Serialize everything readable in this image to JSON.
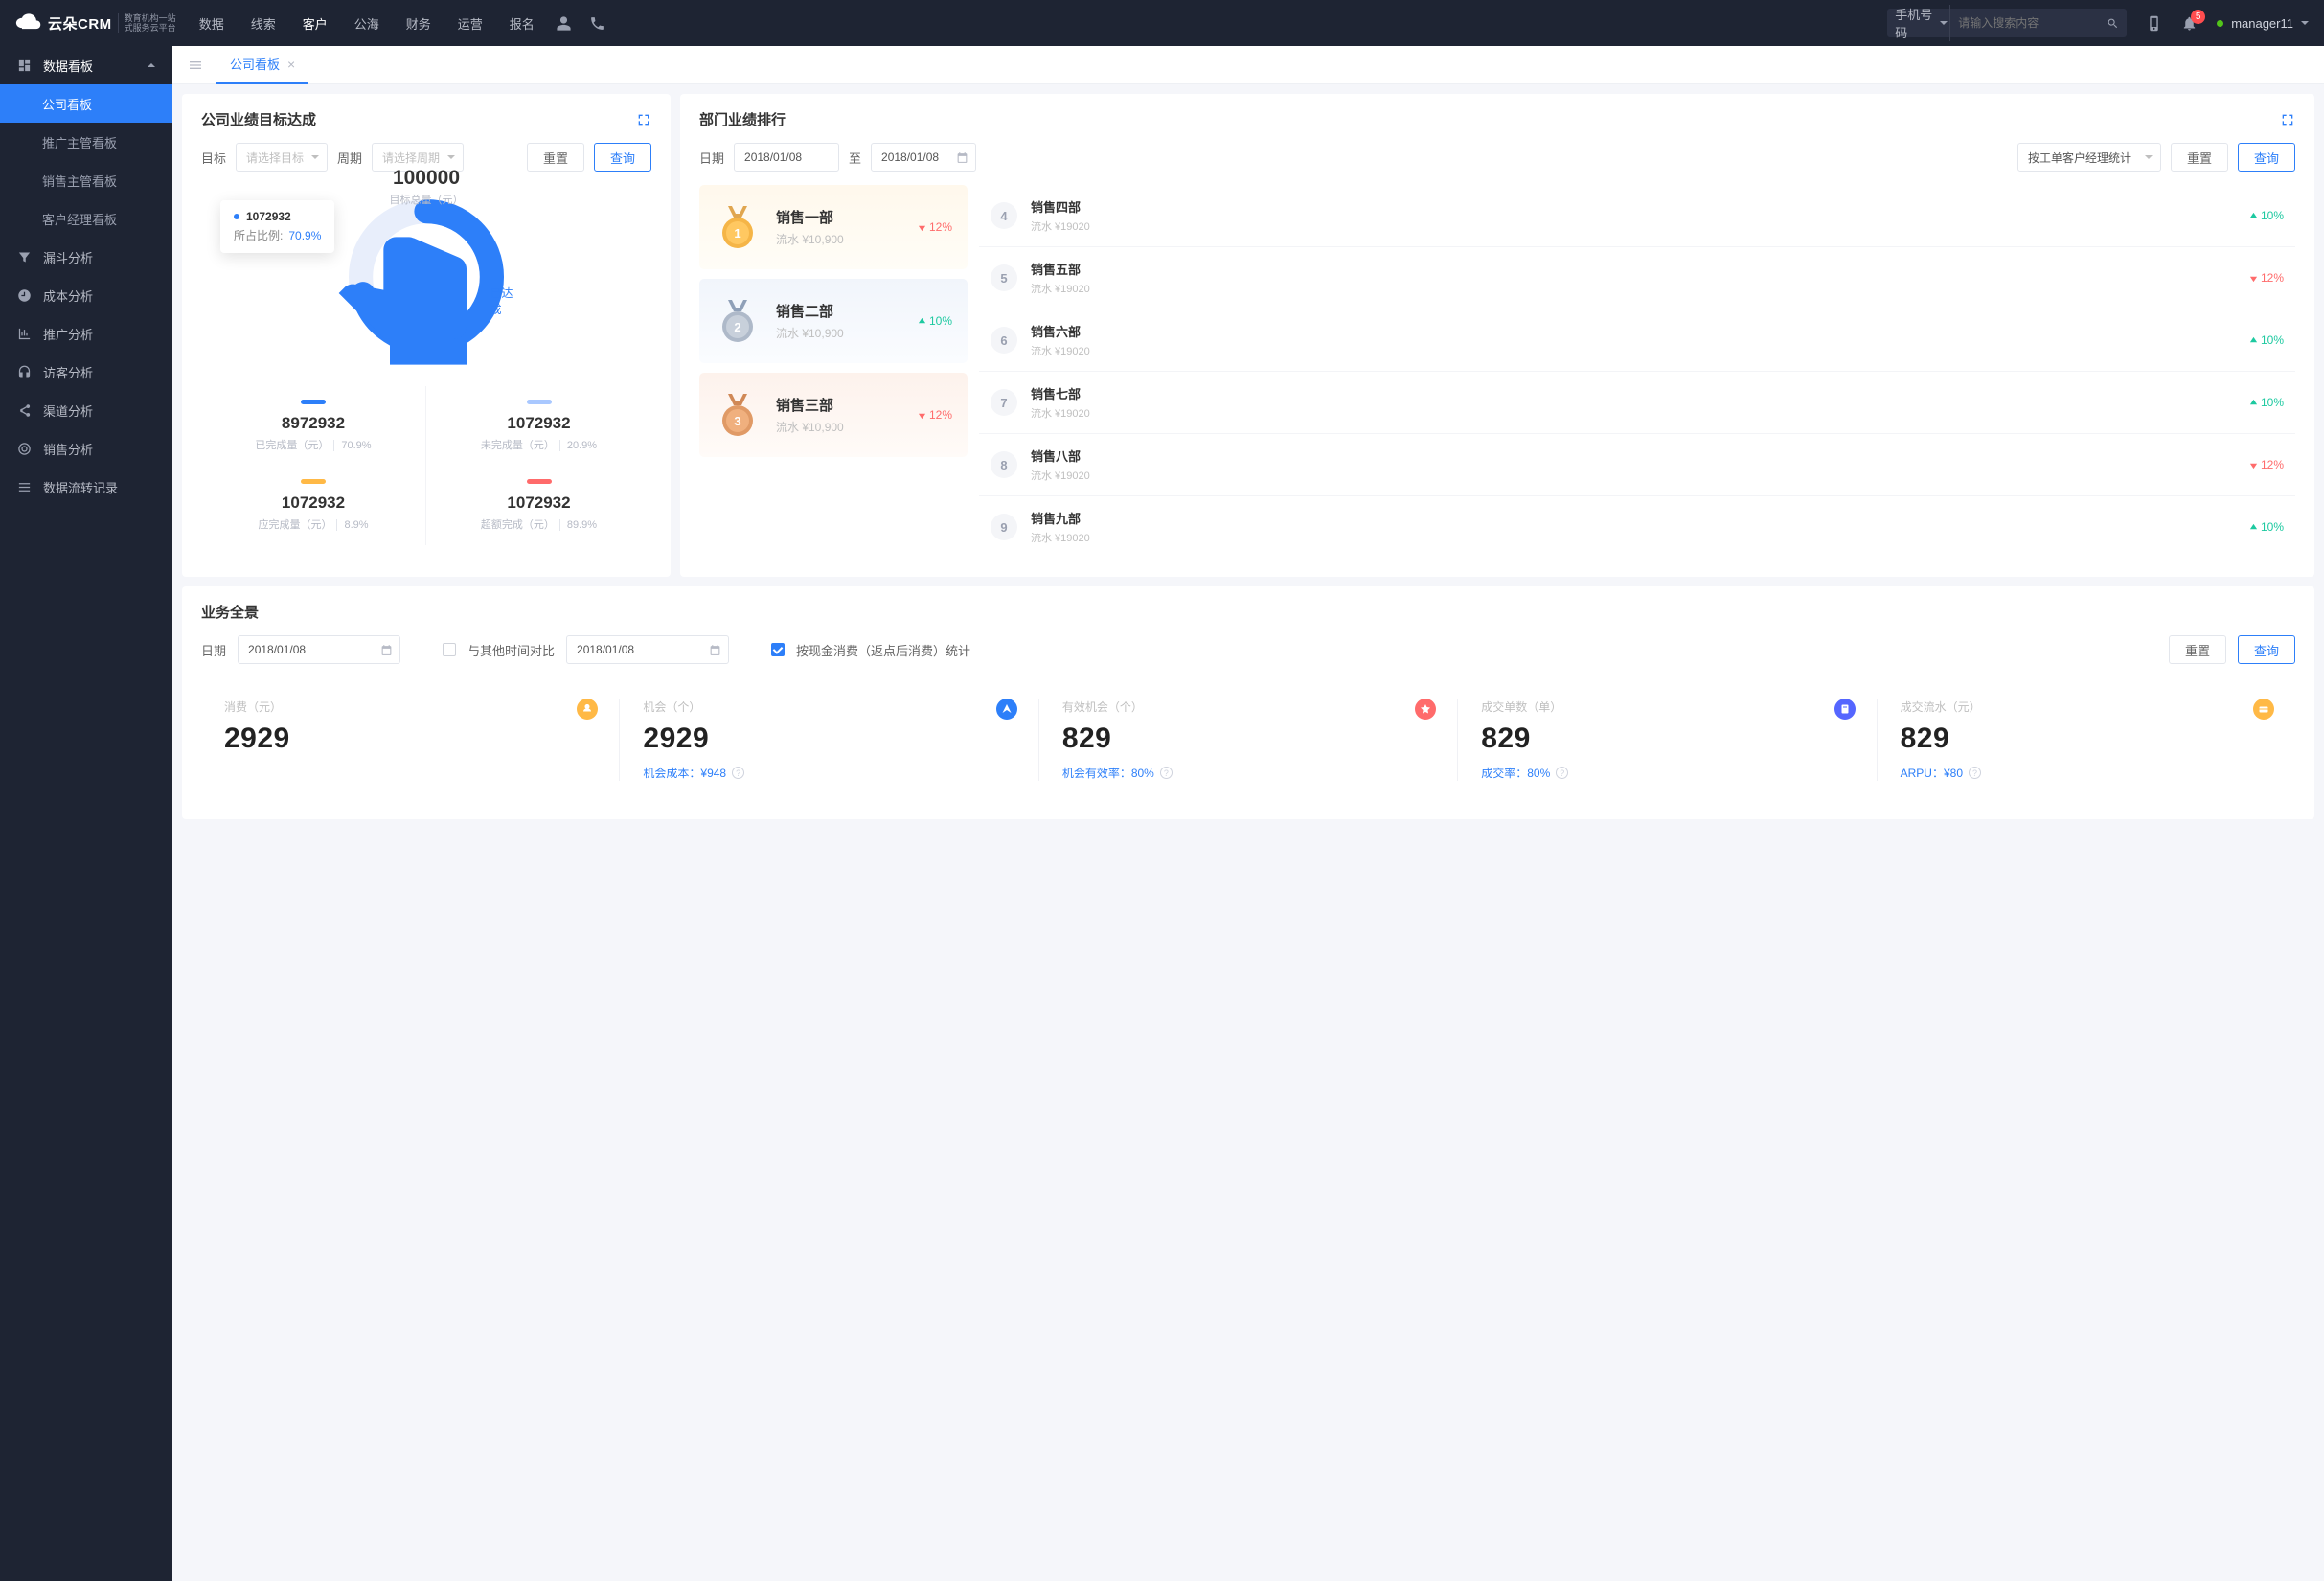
{
  "brand": {
    "name": "云朵CRM",
    "sub1": "教育机构一站",
    "sub2": "式服务云平台"
  },
  "nav": {
    "items": [
      "数据",
      "线索",
      "客户",
      "公海",
      "财务",
      "运营",
      "报名"
    ],
    "active": 2
  },
  "search": {
    "type": "手机号码",
    "placeholder": "请输入搜索内容"
  },
  "notif": {
    "count": "5"
  },
  "user": {
    "name": "manager11"
  },
  "sidebar": {
    "group": "数据看板",
    "subs": [
      "公司看板",
      "推广主管看板",
      "销售主管看板",
      "客户经理看板"
    ],
    "active": 0,
    "items": [
      "漏斗分析",
      "成本分析",
      "推广分析",
      "访客分析",
      "渠道分析",
      "销售分析",
      "数据流转记录"
    ]
  },
  "tab": {
    "label": "公司看板"
  },
  "goal": {
    "title": "公司业绩目标达成",
    "lbl_target": "目标",
    "sel_target": "请选择目标",
    "lbl_period": "周期",
    "sel_period": "请选择周期",
    "btn_reset": "重置",
    "btn_query": "查询",
    "tooltip_v": "1072932",
    "tooltip_lbl": "所占比例:",
    "tooltip_pct": "70.9%",
    "center_v": "100000",
    "center_l": "目标总量（元）",
    "center_tag": "已达成",
    "m": [
      {
        "bar": "#2d7ff9",
        "v": "8972932",
        "l": "已完成量（元）",
        "p": "70.9%"
      },
      {
        "bar": "#a9c8ff",
        "v": "1072932",
        "l": "未完成量（元）",
        "p": "20.9%"
      },
      {
        "bar": "#ffb946",
        "v": "1072932",
        "l": "应完成量（元）",
        "p": "8.9%"
      },
      {
        "bar": "#ff6b6b",
        "v": "1072932",
        "l": "超额完成（元）",
        "p": "89.9%"
      }
    ]
  },
  "rank": {
    "title": "部门业绩排行",
    "lbl_date": "日期",
    "d1": "2018/01/08",
    "to": "至",
    "d2": "2018/01/08",
    "sel_stat": "按工单客户经理统计",
    "btn_reset": "重置",
    "btn_query": "查询",
    "top": [
      {
        "name": "销售一部",
        "sub": "流水 ¥10,900",
        "pct": "12%",
        "dir": "down"
      },
      {
        "name": "销售二部",
        "sub": "流水 ¥10,900",
        "pct": "10%",
        "dir": "up"
      },
      {
        "name": "销售三部",
        "sub": "流水 ¥10,900",
        "pct": "12%",
        "dir": "down"
      }
    ],
    "rest": [
      {
        "n": "4",
        "name": "销售四部",
        "sub": "流水 ¥19020",
        "pct": "10%",
        "dir": "up"
      },
      {
        "n": "5",
        "name": "销售五部",
        "sub": "流水 ¥19020",
        "pct": "12%",
        "dir": "down"
      },
      {
        "n": "6",
        "name": "销售六部",
        "sub": "流水 ¥19020",
        "pct": "10%",
        "dir": "up"
      },
      {
        "n": "7",
        "name": "销售七部",
        "sub": "流水 ¥19020",
        "pct": "10%",
        "dir": "up"
      },
      {
        "n": "8",
        "name": "销售八部",
        "sub": "流水 ¥19020",
        "pct": "12%",
        "dir": "down"
      },
      {
        "n": "9",
        "name": "销售九部",
        "sub": "流水 ¥19020",
        "pct": "10%",
        "dir": "up"
      }
    ]
  },
  "ov": {
    "title": "业务全景",
    "lbl_date": "日期",
    "d1": "2018/01/08",
    "chk_compare": "与其他时间对比",
    "d2": "2018/01/08",
    "chk_cash": "按现金消费（返点后消费）统计",
    "btn_reset": "重置",
    "btn_query": "查询",
    "k": [
      {
        "t": "消费（元）",
        "v": "2929",
        "f": "",
        "ic": "#ffb946"
      },
      {
        "t": "机会（个）",
        "v": "2929",
        "f": "机会成本：¥948",
        "ic": "#2d7ff9"
      },
      {
        "t": "有效机会（个）",
        "v": "829",
        "f": "机会有效率：80%",
        "ic": "#ff6b6b"
      },
      {
        "t": "成交单数（单）",
        "v": "829",
        "f": "成交率：80%",
        "ic": "#5566ff"
      },
      {
        "t": "成交流水（元）",
        "v": "829",
        "f": "ARPU：¥80",
        "ic": "#ffb946"
      }
    ]
  },
  "chart_data": {
    "type": "pie",
    "title": "目标达成",
    "values": [
      {
        "name": "已完成",
        "value": 70.9
      },
      {
        "name": "未完成",
        "value": 29.1
      }
    ],
    "total": 100000
  }
}
